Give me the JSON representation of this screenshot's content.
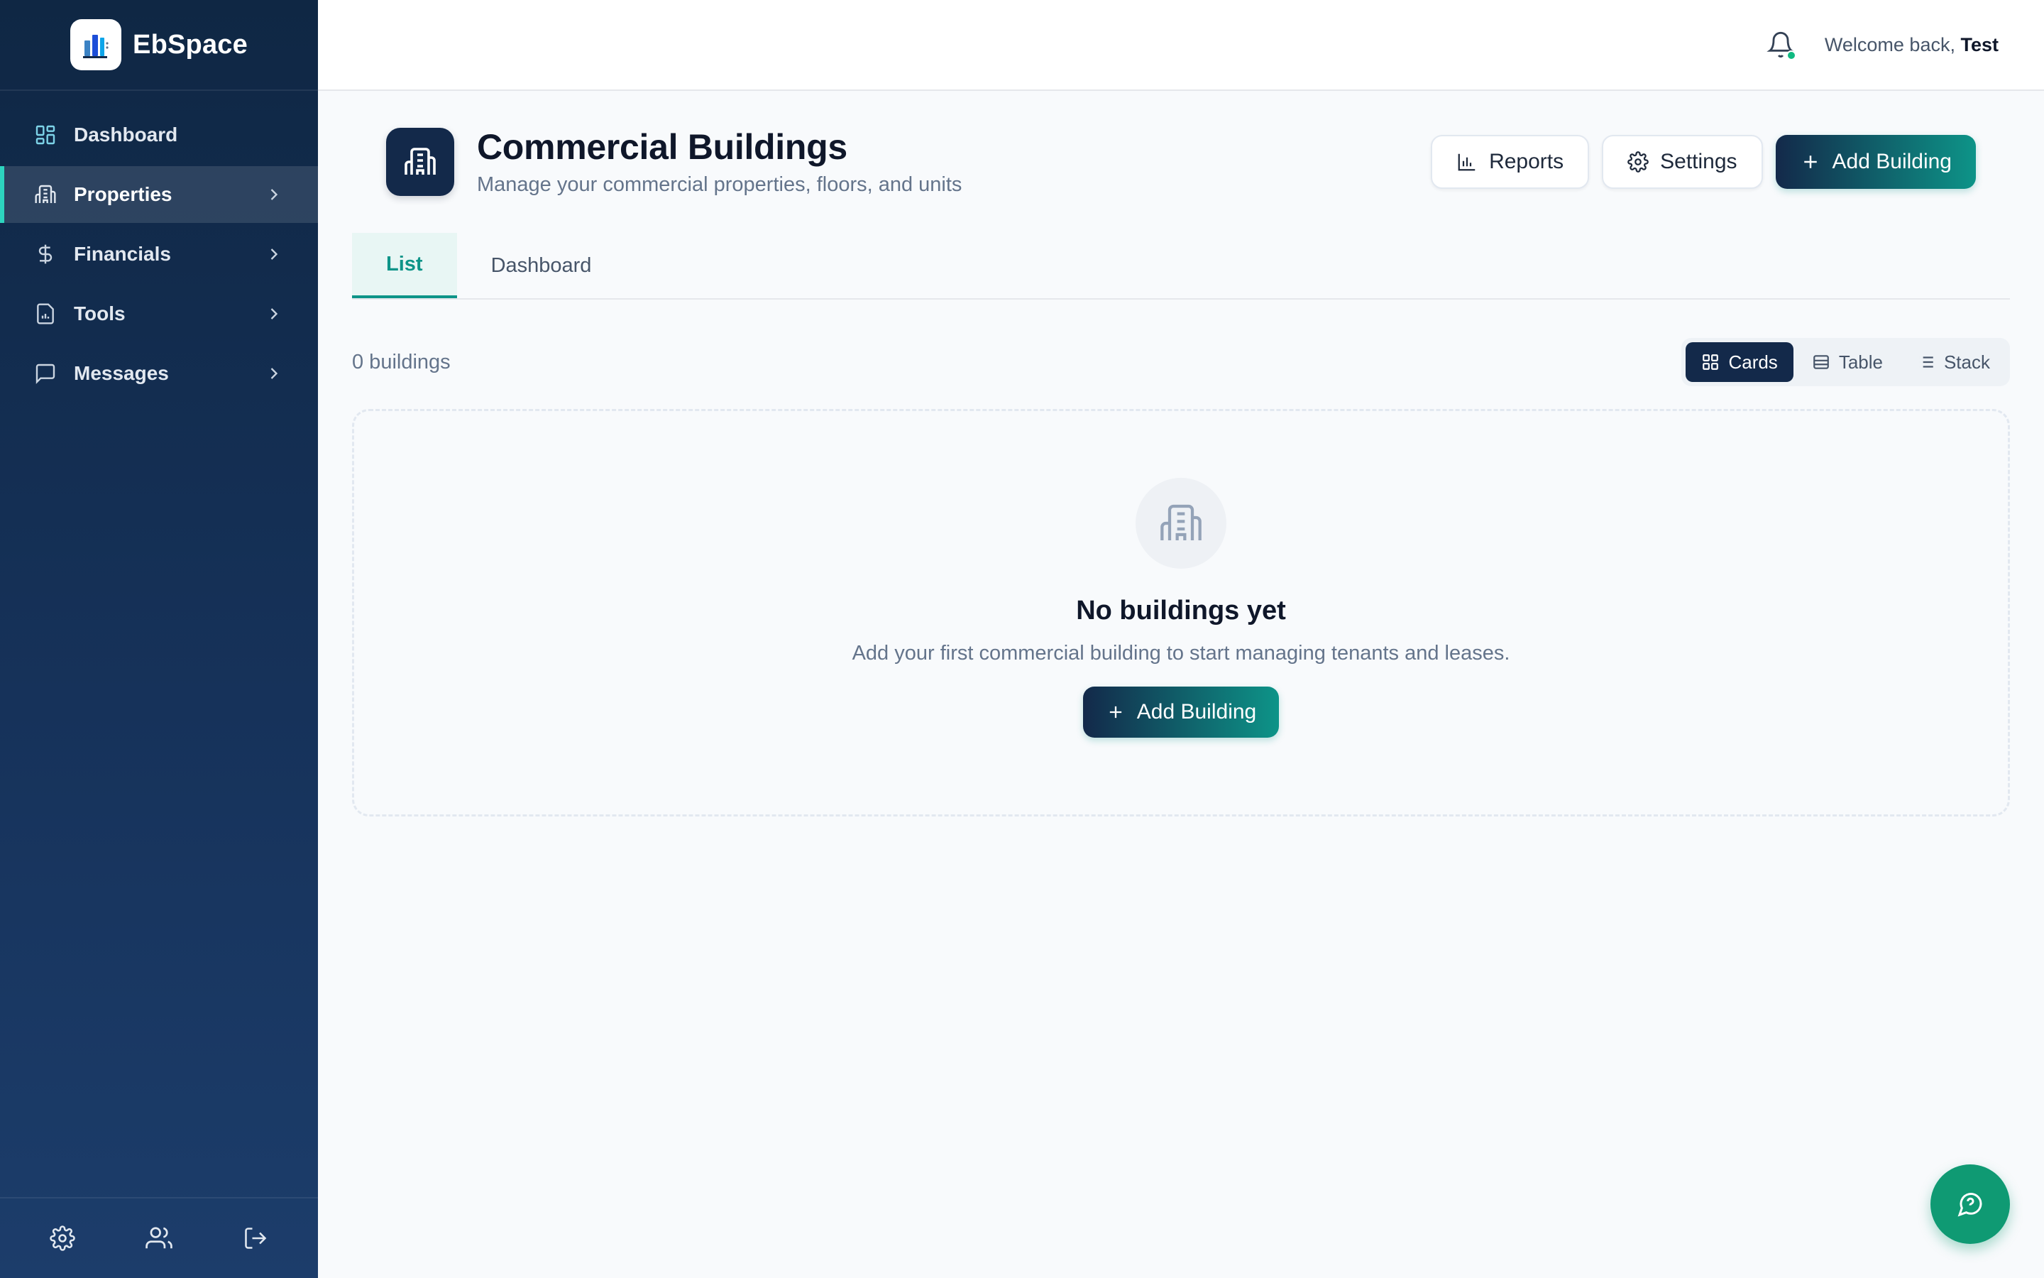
{
  "brand": {
    "name": "EbSpace",
    "icon": "building-chart-logo"
  },
  "sidebar": {
    "items": [
      {
        "label": "Dashboard",
        "icon": "grid-icon",
        "active": false,
        "has_children": false
      },
      {
        "label": "Properties",
        "icon": "building-icon",
        "active": true,
        "has_children": true
      },
      {
        "label": "Financials",
        "icon": "dollar-icon",
        "active": false,
        "has_children": true
      },
      {
        "label": "Tools",
        "icon": "calculator-icon",
        "active": false,
        "has_children": true
      },
      {
        "label": "Messages",
        "icon": "message-icon",
        "active": false,
        "has_children": true
      }
    ],
    "footer": [
      "gear-icon",
      "users-icon",
      "logout-icon"
    ]
  },
  "topbar": {
    "welcome_prefix": "Welcome back,",
    "user_name": "Test",
    "notification_dot_color": "#10b981"
  },
  "page": {
    "title": "Commercial Buildings",
    "subtitle": "Manage your commercial properties, floors, and units",
    "actions": {
      "reports": "Reports",
      "settings": "Settings",
      "add_building": "Add Building"
    },
    "tabs": [
      {
        "label": "List",
        "active": true
      },
      {
        "label": "Dashboard",
        "active": false
      }
    ],
    "count_text": "0 buildings",
    "view_modes": [
      {
        "label": "Cards",
        "icon": "cards-icon",
        "active": true
      },
      {
        "label": "Table",
        "icon": "table-icon",
        "active": false
      },
      {
        "label": "Stack",
        "icon": "list-icon",
        "active": false
      }
    ],
    "empty_state": {
      "title": "No buildings yet",
      "text": "Add your first commercial building to start managing tenants and leases.",
      "button": "Add Building"
    }
  },
  "colors": {
    "sidebar_bg": "#0f2744",
    "accent_teal": "#0d9488",
    "primary_navy": "#13294a",
    "help_button": "#0f9a73"
  }
}
